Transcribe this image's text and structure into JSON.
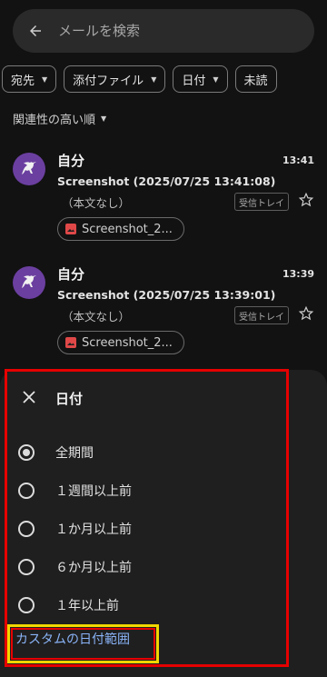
{
  "search": {
    "placeholder": "メールを検索",
    "back_icon": "arrow-left-icon"
  },
  "chips": [
    {
      "label": "宛先",
      "has_caret": true
    },
    {
      "label": "添付ファイル",
      "has_caret": true
    },
    {
      "label": "日付",
      "has_caret": true
    },
    {
      "label": "未読",
      "has_caret": false
    }
  ],
  "sort": {
    "label": "関連性の高い順"
  },
  "emails": [
    {
      "sender": "自分",
      "time": "13:41",
      "subject": "Screenshot (2025/07/25 13:41:08)",
      "snippet": "（本文なし）",
      "label": "受信トレイ",
      "attachment": "Screenshot_2..."
    },
    {
      "sender": "自分",
      "time": "13:39",
      "subject": "Screenshot (2025/07/25 13:39:01)",
      "snippet": "（本文なし）",
      "label": "受信トレイ",
      "attachment": "Screenshot_2..."
    }
  ],
  "sheet": {
    "title": "日付",
    "options": [
      {
        "label": "全期間",
        "selected": true
      },
      {
        "label": "１週間以上前",
        "selected": false
      },
      {
        "label": "１か月以上前",
        "selected": false
      },
      {
        "label": "６か月以上前",
        "selected": false
      },
      {
        "label": "１年以上前",
        "selected": false
      }
    ],
    "custom_range": "カスタムの日付範囲"
  },
  "colors": {
    "background": "#121212",
    "link": "#8ab4f8",
    "highlight_red": "#e60000",
    "highlight_yellow": "#f2d600",
    "avatar": "#6b3fa0"
  }
}
